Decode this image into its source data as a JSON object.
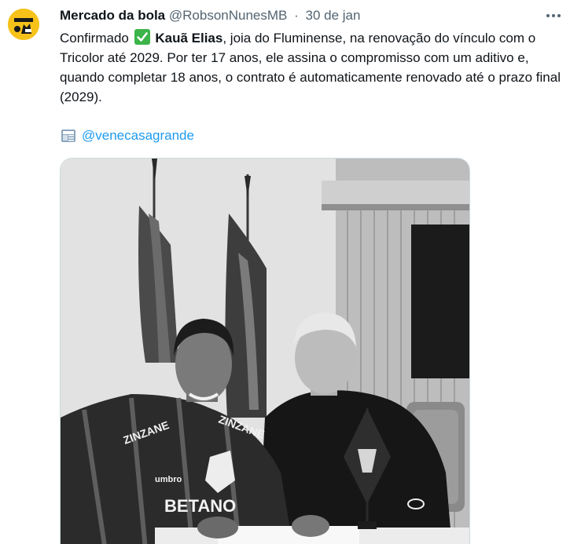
{
  "author": {
    "display_name": "Mercado da bola",
    "handle": "@RobsonNunesMB",
    "separator": "·",
    "date": "30 de jan",
    "avatar_icon": "robson-logo-avatar"
  },
  "tweet": {
    "part1": "Confirmado",
    "check_icon": "white-check-mark-emoji",
    "player_name": "Kauã Elias",
    "part2": ", joia do Fluminense, na renovação do vínculo com o Tricolor até 2029. Por ter 17 anos, ele assina o compromisso com um aditivo e, quando completar 18 anos, o contrato é automaticamente renovado até o prazo final (2029).",
    "source_icon": "newspaper-icon",
    "source_mention": "@venecasagrande"
  },
  "media": {
    "shirt_text": [
      "ZINZANE",
      "umbro",
      "BETANO"
    ]
  },
  "colors": {
    "accent": "#1d9bf0",
    "avatar_bg": "#f6c21a",
    "text": "#0f1419",
    "muted": "#536471",
    "check_green": "#3cb44a"
  }
}
